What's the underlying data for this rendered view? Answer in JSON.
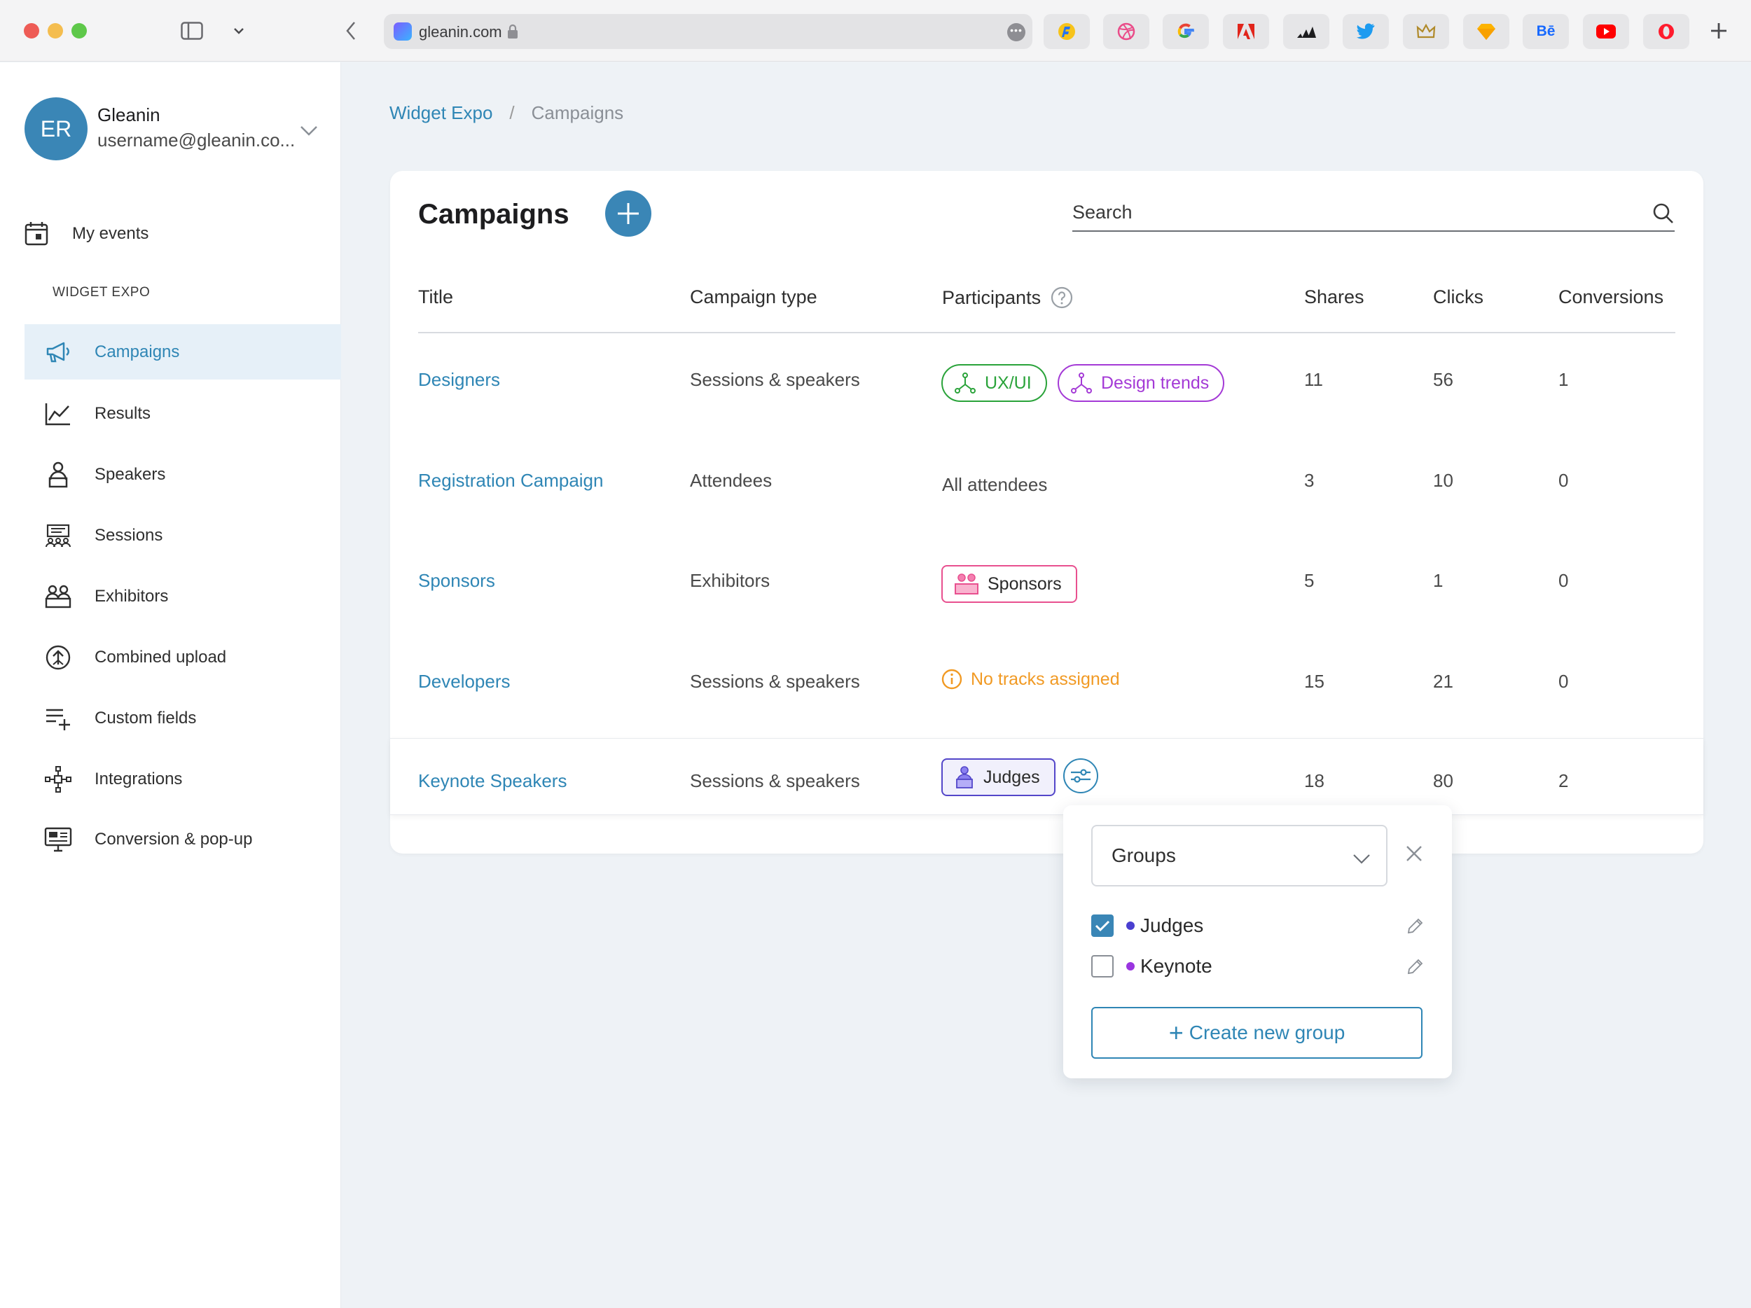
{
  "browser": {
    "url": "gleanin.com"
  },
  "account": {
    "initials": "ER",
    "name": "Gleanin",
    "email": "username@gleanin.co..."
  },
  "sidebar": {
    "my_events": "My events",
    "section": "WIDGET EXPO",
    "items": [
      {
        "label": "Campaigns",
        "icon": "megaphone-icon",
        "active": true
      },
      {
        "label": "Results",
        "icon": "line-chart-icon"
      },
      {
        "label": "Speakers",
        "icon": "speaker-icon"
      },
      {
        "label": "Sessions",
        "icon": "sessions-icon"
      },
      {
        "label": "Exhibitors",
        "icon": "exhibitors-icon"
      },
      {
        "label": "Combined upload",
        "icon": "upload-icon"
      },
      {
        "label": "Custom fields",
        "icon": "custom-fields-icon"
      },
      {
        "label": "Integrations",
        "icon": "integrations-icon"
      },
      {
        "label": "Conversion & pop-up",
        "icon": "popup-icon"
      }
    ]
  },
  "breadcrumb": {
    "parent": "Widget Expo",
    "separator": "/",
    "current": "Campaigns"
  },
  "campaigns": {
    "title": "Campaigns",
    "search_placeholder": "Search",
    "columns": {
      "title": "Title",
      "type": "Campaign type",
      "participants": "Participants",
      "shares": "Shares",
      "clicks": "Clicks",
      "conversions": "Conversions"
    },
    "rows": [
      {
        "title": "Designers",
        "type": "Sessions & speakers",
        "chips": [
          {
            "label": "UX/UI",
            "color": "#2aa33a"
          },
          {
            "label": "Design trends",
            "color": "#a43ad6"
          }
        ],
        "shares": "11",
        "clicks": "56",
        "conversions": "1"
      },
      {
        "title": "Registration Campaign",
        "type": "Attendees",
        "participants_text": "All attendees",
        "shares": "3",
        "clicks": "10",
        "conversions": "0"
      },
      {
        "title": "Sponsors",
        "type": "Exhibitors",
        "chips": [
          {
            "label": "Sponsors",
            "color": "#e8508f"
          }
        ],
        "shares": "5",
        "clicks": "1",
        "conversions": "0"
      },
      {
        "title": "Developers",
        "type": "Sessions & speakers",
        "warning": "No tracks assigned",
        "shares": "15",
        "clicks": "21",
        "conversions": "0"
      },
      {
        "title": "Keynote Speakers",
        "type": "Sessions & speakers",
        "chips": [
          {
            "label": "Judges",
            "color": "#5346c9"
          }
        ],
        "shares": "18",
        "clicks": "80",
        "conversions": "2"
      }
    ]
  },
  "groups_popover": {
    "select_value": "Groups",
    "groups": [
      {
        "label": "Judges",
        "checked": true,
        "color": "#4a3fd0"
      },
      {
        "label": "Keynote",
        "checked": false,
        "color": "#9a35e0"
      }
    ],
    "create_label": "Create new group"
  },
  "colors": {
    "accent": "#3a86b6",
    "link": "#2f86b5",
    "warning": "#f19a24"
  }
}
